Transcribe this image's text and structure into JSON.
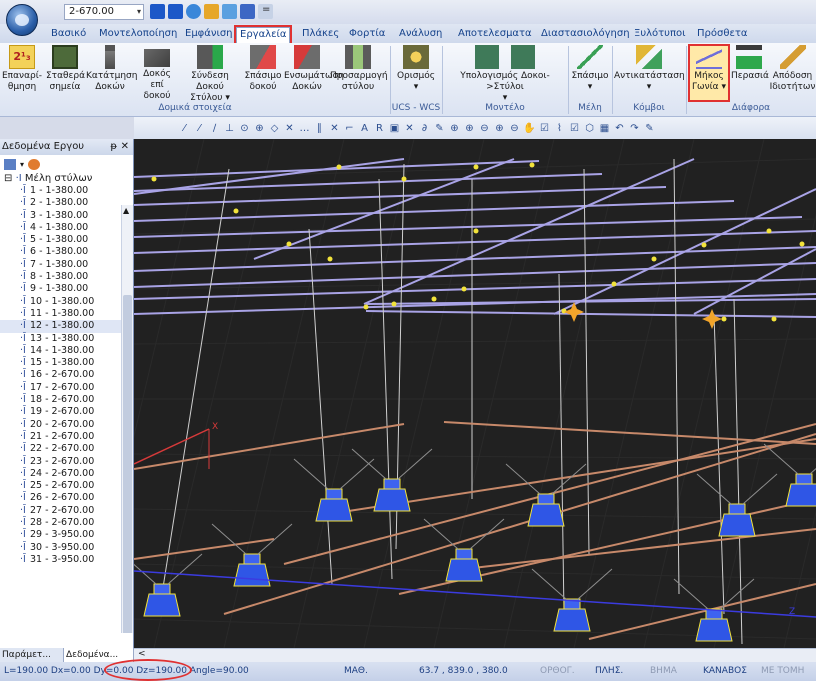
{
  "quick_access": {
    "combo_value": "2-670.00",
    "more": "="
  },
  "tabs": [
    {
      "label": "Βασικό"
    },
    {
      "label": "Μοντελοποίηση"
    },
    {
      "label": "Εμφάνιση"
    },
    {
      "label": "Εργαλεία"
    },
    {
      "label": "Πλάκες"
    },
    {
      "label": "Φορτία"
    },
    {
      "label": "Ανάλυση"
    },
    {
      "label": "Αποτελεσματα"
    },
    {
      "label": "Διαστασιολόγηση"
    },
    {
      "label": "Ξυλότυποι"
    },
    {
      "label": "Πρόσθετα"
    }
  ],
  "ribbon": {
    "buttons": [
      {
        "l1": "Επαναρί-",
        "l2": "θμηση"
      },
      {
        "l1": "Σταθερά",
        "l2": "σημεία"
      },
      {
        "l1": "Κατάτμηση",
        "l2": "Δοκών"
      },
      {
        "l1": "Δοκός επί",
        "l2": "δοκού"
      },
      {
        "l1": "Σύνδεση Δοκού",
        "l2": "Στύλου ▾"
      },
      {
        "l1": "Σπάσιμο",
        "l2": "δοκού"
      },
      {
        "l1": "Ενσωμάτωση",
        "l2": "Δοκών"
      },
      {
        "l1": "Προσαρμογή",
        "l2": "στύλου"
      },
      {
        "l1": "Ορισμός",
        "l2": "▾"
      },
      {
        "l1": "Υπολογισμός Δοκοι->Στύλοι",
        "l2": "▾"
      },
      {
        "l1": "Σπάσιμο",
        "l2": "▾"
      },
      {
        "l1": "Αντικατάσταση",
        "l2": "▾"
      },
      {
        "l1": "Μήκος",
        "l2": "Γωνία ▾"
      },
      {
        "l1": "Περασιά",
        "l2": ""
      },
      {
        "l1": "Απόδοση",
        "l2": "Ιδιοτήτων"
      }
    ],
    "groups": [
      "Δομικά στοιχεία",
      "UCS - WCS",
      "Μοντέλο",
      "Μέλη",
      "Κόμβοι",
      "Διάφορα"
    ]
  },
  "panel": {
    "title": "Δεδομένα Εργου",
    "pin": "ᵽ",
    "close": "✕",
    "root": "Μέλη στύλων",
    "items": [
      "1 - 1-380.00",
      "2 - 1-380.00",
      "3 - 1-380.00",
      "4 - 1-380.00",
      "5 - 1-380.00",
      "6 - 1-380.00",
      "7 - 1-380.00",
      "8 - 1-380.00",
      "9 - 1-380.00",
      "10 - 1-380.00",
      "11 - 1-380.00",
      "12 - 1-380.00",
      "13 - 1-380.00",
      "14 - 1-380.00",
      "15 - 1-380.00",
      "16 - 2-670.00",
      "17 - 2-670.00",
      "18 - 2-670.00",
      "19 - 2-670.00",
      "20 - 2-670.00",
      "21 - 2-670.00",
      "22 - 2-670.00",
      "23 - 2-670.00",
      "24 - 2-670.00",
      "25 - 2-670.00",
      "26 - 2-670.00",
      "27 - 2-670.00",
      "28 - 2-670.00",
      "29 - 3-950.00",
      "30 - 3-950.00",
      "31 - 3-950.00"
    ],
    "selected_index": 11,
    "bottom_tabs": [
      "Παράμετ...",
      "Δεδομένα..."
    ]
  },
  "viewport": {
    "axis_x": "X",
    "axis_z": "Z"
  },
  "status": {
    "coords_text": "L=190.00 Dx=0.00 Dy=0.00 Dz=190.00 Angle=90.00",
    "math": "ΜΑΘ.",
    "position": "63.7 , 839.0 , 380.0",
    "ortho": "ΟΡΘΟΓ.",
    "plis": "ΠΛΗΣ.",
    "step": "ΒΗΜΑ",
    "grid": "ΚΑΝΑΒΟΣ",
    "section": "ΜΕ ΤΟΜΗ"
  },
  "colors": {
    "accent_red": "#e03131",
    "viewport_bg": "#212121",
    "beam": "#a9a3e6",
    "footing": "#2f56e6",
    "node": "#f2e33b",
    "tie": "#c7896a"
  }
}
